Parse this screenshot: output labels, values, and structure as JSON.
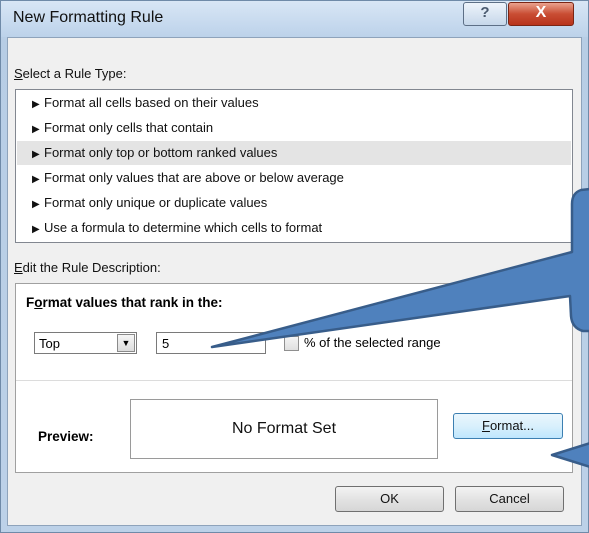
{
  "dialog": {
    "title": "New Formatting Rule",
    "help_label": "?",
    "close_label": "X"
  },
  "rule_type": {
    "label_accesskey": "S",
    "label_rest": "elect a Rule Type:",
    "items": [
      {
        "label": "Format all cells based on their values",
        "selected": false
      },
      {
        "label": "Format only cells that contain",
        "selected": false
      },
      {
        "label": "Format only top or bottom ranked values",
        "selected": true
      },
      {
        "label": "Format only values that are above or below average",
        "selected": false
      },
      {
        "label": "Format only unique or duplicate values",
        "selected": false
      },
      {
        "label": "Use a formula to determine which cells to format",
        "selected": false
      }
    ],
    "bullet_glyph": "▶"
  },
  "description": {
    "label_accesskey": "E",
    "label_rest": "dit the Rule Description:",
    "rank_label_pre": "F",
    "rank_label_accesskey": "o",
    "rank_label_post": "rmat values that rank in the:",
    "rank_direction": "Top",
    "rank_value": "5",
    "percent_label_pre": "% of the selected ran",
    "percent_label_accesskey": "g",
    "percent_label_post": "e",
    "percent_checked": false,
    "preview_label": "Preview:",
    "preview_text": "No Format Set",
    "format_button_accesskey": "F",
    "format_button_rest": "ormat..."
  },
  "buttons": {
    "ok": "OK",
    "cancel": "Cancel"
  },
  "colors": {
    "callout_fill": "#4f81bd",
    "callout_stroke": "#385d8a",
    "selection": "#e4e4e4"
  }
}
